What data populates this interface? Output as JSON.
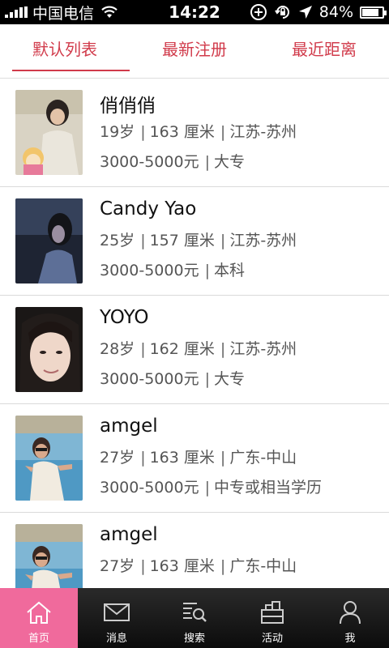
{
  "status_bar": {
    "carrier": "中国电信",
    "time": "14:22",
    "battery": "84%",
    "battery_level": 0.84
  },
  "tabs": [
    {
      "label": "默认列表",
      "active": true
    },
    {
      "label": "最新注册",
      "active": false
    },
    {
      "label": "最近距离",
      "active": false
    }
  ],
  "users": [
    {
      "name": "俏俏俏",
      "age": "19岁",
      "height": "163 厘米",
      "location": "江苏-苏州",
      "income": "3000-5000元",
      "education": "大专"
    },
    {
      "name": "Candy Yao",
      "age": "25岁",
      "height": "157 厘米",
      "location": "江苏-苏州",
      "income": "3000-5000元",
      "education": "本科"
    },
    {
      "name": "YOYO",
      "age": "28岁",
      "height": "162 厘米",
      "location": "江苏-苏州",
      "income": "3000-5000元",
      "education": "大专"
    },
    {
      "name": "amgel",
      "age": "27岁",
      "height": "163 厘米",
      "location": "广东-中山",
      "income": "3000-5000元",
      "education": "中专或相当学历"
    },
    {
      "name": "amgel",
      "age": "27岁",
      "height": "163 厘米",
      "location": "广东-中山",
      "income": "",
      "education": ""
    }
  ],
  "tab_bar": [
    {
      "label": "首页",
      "icon": "home-icon",
      "active": true
    },
    {
      "label": "消息",
      "icon": "message-icon",
      "active": false
    },
    {
      "label": "搜索",
      "icon": "search-icon",
      "active": false
    },
    {
      "label": "活动",
      "icon": "activity-icon",
      "active": false
    },
    {
      "label": "我",
      "icon": "profile-icon",
      "active": false
    }
  ],
  "colors": {
    "accent": "#d13b4b",
    "tab_active_bg": "#f06a9c"
  }
}
